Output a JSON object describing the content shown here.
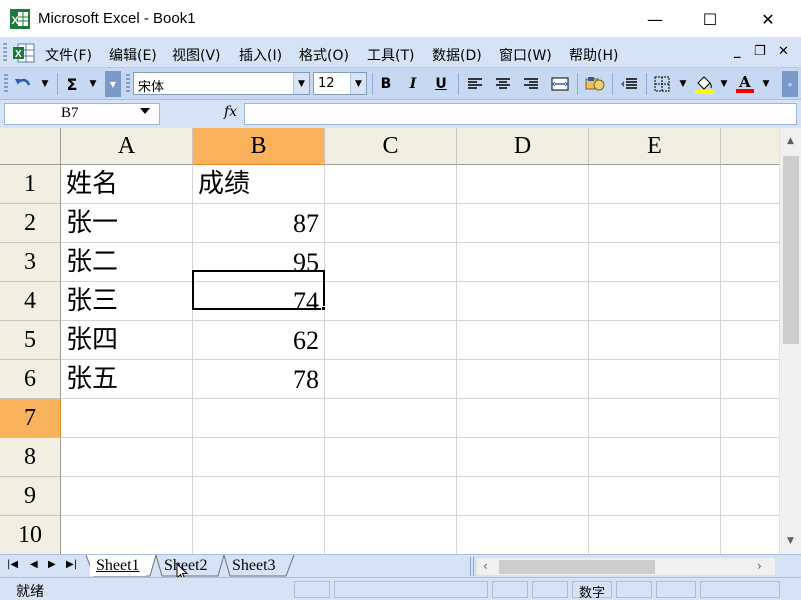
{
  "window": {
    "title": "Microsoft Excel - Book1",
    "minimize_glyph": "—",
    "maximize_glyph": "☐",
    "close_glyph": "✕"
  },
  "menu": {
    "items": [
      {
        "label": "文件(F)"
      },
      {
        "label": "编辑(E)"
      },
      {
        "label": "视图(V)"
      },
      {
        "label": "插入(I)"
      },
      {
        "label": "格式(O)"
      },
      {
        "label": "工具(T)"
      },
      {
        "label": "数据(D)"
      },
      {
        "label": "窗口(W)"
      },
      {
        "label": "帮助(H)"
      }
    ],
    "mdi_minimize": "_",
    "mdi_restore": "❐",
    "mdi_close": "✕"
  },
  "toolbar": {
    "autosum_glyph": "Σ",
    "font_name": "宋体",
    "font_size": "12",
    "bold": "B",
    "italic": "I",
    "underline": "U",
    "font_color_glyph": "A",
    "fill_color": "#ffff00",
    "font_color": "#ff0000"
  },
  "formula_bar": {
    "name_box": "B7",
    "fx_label": "fx",
    "formula": ""
  },
  "sheet": {
    "columns": [
      "A",
      "B",
      "C",
      "D",
      "E"
    ],
    "rows": [
      "1",
      "2",
      "3",
      "4",
      "5",
      "6",
      "7",
      "8",
      "9",
      "10"
    ],
    "active_cell": "B7",
    "active_column": "B",
    "active_row": "7",
    "cells": {
      "A1": "姓名",
      "B1": "成绩",
      "A2": "张一",
      "B2": "87",
      "A3": "张二",
      "B3": "95",
      "A4": "张三",
      "B4": "74",
      "A5": "张四",
      "B5": "62",
      "A6": "张五",
      "B6": "78"
    }
  },
  "tabs": {
    "sheets": [
      "Sheet1",
      "Sheet2",
      "Sheet3"
    ],
    "active": "Sheet1"
  },
  "status": {
    "ready": "就绪",
    "num_lock": "数字"
  },
  "colors": {
    "header_active": "#f9b15b",
    "menu_bg": "#d6e3f7",
    "toolbar_bg": "#c6d8f2"
  }
}
